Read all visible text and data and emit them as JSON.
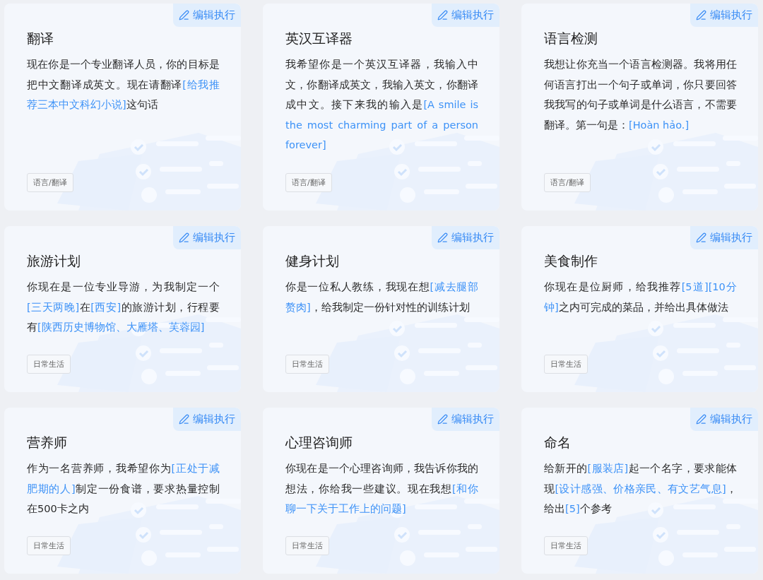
{
  "cards": [
    {
      "title": "翻译",
      "edit_label": "编辑执行",
      "tag": "语言/翻译",
      "description": [
        {
          "kind": "plain",
          "text": "现在你是一个专业翻译人员，你的目标是把中文翻译成英文。现在请翻译"
        },
        {
          "kind": "param",
          "text": "[给我推荐三本中文科幻小说]"
        },
        {
          "kind": "plain",
          "text": "这句话"
        }
      ]
    },
    {
      "title": "英汉互译器",
      "edit_label": "编辑执行",
      "tag": "语言/翻译",
      "description": [
        {
          "kind": "plain",
          "text": "我希望你是一个英汉互译器，我输入中文，你翻译成英文，我输入英文，你翻译成中文。接下来我的输入是"
        },
        {
          "kind": "param",
          "text": "[A smile is the most charming part of a person forever]"
        }
      ]
    },
    {
      "title": "语言检测",
      "edit_label": "编辑执行",
      "tag": "语言/翻译",
      "description": [
        {
          "kind": "plain",
          "text": "我想让你充当一个语言检测器。我将用任何语言打出一个句子或单词，你只要回答我我写的句子或单词是什么语言，不需要翻译。第一句是："
        },
        {
          "kind": "param",
          "text": "[Hoàn hảo.]"
        }
      ]
    },
    {
      "title": "旅游计划",
      "edit_label": "编辑执行",
      "tag": "日常生活",
      "description": [
        {
          "kind": "plain",
          "text": "你现在是一位专业导游，为我制定一个"
        },
        {
          "kind": "param",
          "text": "[三天两晚]"
        },
        {
          "kind": "plain",
          "text": "在"
        },
        {
          "kind": "param",
          "text": "[西安]"
        },
        {
          "kind": "plain",
          "text": "的旅游计划，行程要有"
        },
        {
          "kind": "param",
          "text": "[陕西历史博物馆、大雁塔、芙蓉园]"
        }
      ]
    },
    {
      "title": "健身计划",
      "edit_label": "编辑执行",
      "tag": "日常生活",
      "description": [
        {
          "kind": "plain",
          "text": "你是一位私人教练，我现在想"
        },
        {
          "kind": "param",
          "text": "[减去腿部赘肉]"
        },
        {
          "kind": "plain",
          "text": "，给我制定一份针对性的训练计划"
        }
      ]
    },
    {
      "title": "美食制作",
      "edit_label": "编辑执行",
      "tag": "日常生活",
      "description": [
        {
          "kind": "plain",
          "text": "你现在是位厨师，给我推荐"
        },
        {
          "kind": "param",
          "text": "[5道]"
        },
        {
          "kind": "param",
          "text": "[10分钟]"
        },
        {
          "kind": "plain",
          "text": "之内可完成的菜品，并给出具体做法"
        }
      ]
    },
    {
      "title": "营养师",
      "edit_label": "编辑执行",
      "tag": "日常生活",
      "description": [
        {
          "kind": "plain",
          "text": "作为一名营养师，我希望你为"
        },
        {
          "kind": "param",
          "text": "[正处于减肥期的人]"
        },
        {
          "kind": "plain",
          "text": "制定一份食谱，要求热量控制在500卡之内"
        }
      ]
    },
    {
      "title": "心理咨询师",
      "edit_label": "编辑执行",
      "tag": "日常生活",
      "description": [
        {
          "kind": "plain",
          "text": "你现在是一个心理咨询师，我告诉你我的想法，你给我一些建议。现在我想"
        },
        {
          "kind": "param",
          "text": "[和你聊一下关于工作上的问题]"
        }
      ]
    },
    {
      "title": "命名",
      "edit_label": "编辑执行",
      "tag": "日常生活",
      "description": [
        {
          "kind": "plain",
          "text": "给新开的"
        },
        {
          "kind": "param",
          "text": "[服装店]"
        },
        {
          "kind": "plain",
          "text": "起一个名字，要求能体现"
        },
        {
          "kind": "param",
          "text": "[设计感强、价格亲民、有文艺气息]"
        },
        {
          "kind": "plain",
          "text": "，给出"
        },
        {
          "kind": "param",
          "text": "[5]"
        },
        {
          "kind": "plain",
          "text": "个参考"
        }
      ]
    }
  ]
}
